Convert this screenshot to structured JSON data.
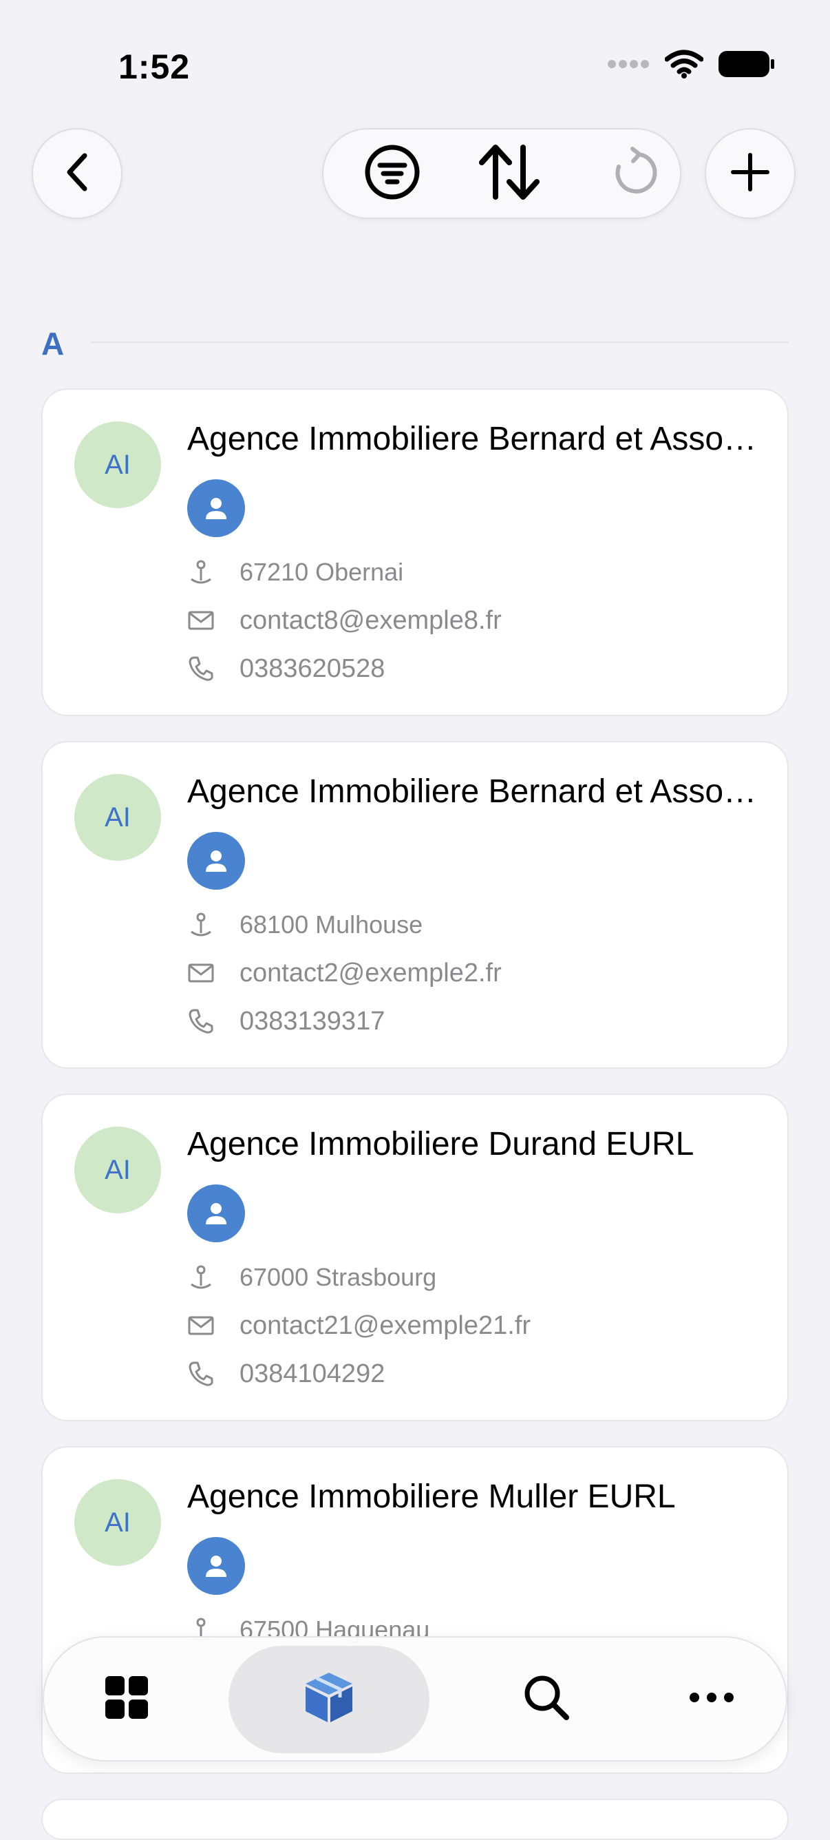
{
  "status_bar": {
    "time": "1:52",
    "signal_icon": "cellular-dots-icon",
    "wifi_icon": "wifi-icon",
    "battery_icon": "battery-icon"
  },
  "toolbar": {
    "back_icon": "chevron-left-icon",
    "filter_icon": "filter-icon",
    "sort_icon": "sort-arrows-icon",
    "refresh_icon": "refresh-icon",
    "add_icon": "plus-icon"
  },
  "section": {
    "letter": "A"
  },
  "contacts": [
    {
      "initials": "AI",
      "name": "Agence Immobiliere Bernard et Associés",
      "city": "67210 Obernai",
      "email": "contact8@exemple8.fr",
      "phone": "0383620528"
    },
    {
      "initials": "AI",
      "name": "Agence Immobiliere Bernard et Associés",
      "city": "68100 Mulhouse",
      "email": "contact2@exemple2.fr",
      "phone": "0383139317"
    },
    {
      "initials": "AI",
      "name": "Agence Immobiliere Durand EURL",
      "city": "67000 Strasbourg",
      "email": "contact21@exemple21.fr",
      "phone": "0384104292"
    },
    {
      "initials": "AI",
      "name": "Agence Immobiliere Muller EURL",
      "city": "67500 Haguenau"
    }
  ],
  "tab_bar": {
    "items": [
      {
        "icon": "grid-icon",
        "active": false
      },
      {
        "icon": "box-icon",
        "active": true
      },
      {
        "icon": "search-icon",
        "active": false
      },
      {
        "icon": "more-icon",
        "active": false
      }
    ],
    "accent_color": "#3d72c8"
  },
  "colors": {
    "background": "#f2f2f7",
    "section_letter": "#3d6fc4",
    "avatar_bg": "#cfe9c8",
    "avatar_text": "#3d72c8",
    "person_badge": "#4a84d0",
    "secondary_text": "#8a8a8e"
  }
}
